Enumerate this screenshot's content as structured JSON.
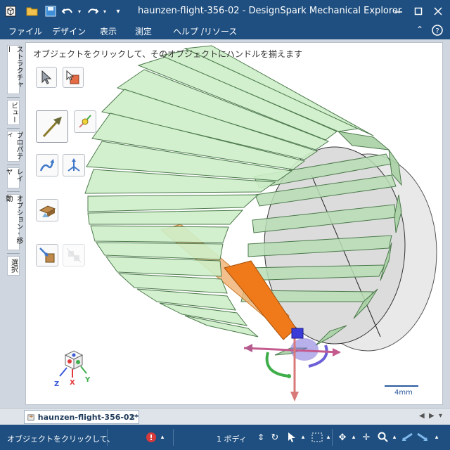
{
  "app": {
    "title": "haunzen-flight-356-02 - DesignSpark Mechanical Explorer",
    "icon": "cube-app-icon",
    "quick_access": [
      "open-folder-icon",
      "save-icon",
      "undo-icon",
      "redo-icon"
    ],
    "window_controls": [
      "minimize-icon",
      "maximize-icon",
      "close-icon"
    ]
  },
  "menu": {
    "items": [
      "ファイル",
      "デザイン",
      "表示",
      "測定",
      "ヘルプ /リソース"
    ],
    "collapse_icon": "chevron-up-icon",
    "help_icon": "help-icon"
  },
  "side_tabs": [
    "ストラクチャー",
    "ビュー",
    "プロパティ",
    "レイヤ",
    "オプション - 移動",
    "選択"
  ],
  "viewport": {
    "hint": "オブジェクトをクリックして、そのオブジェクトにハンドルを揃えます",
    "scale_label": "4mm",
    "axis_labels": {
      "x": "X",
      "y": "Y",
      "z": "Z"
    }
  },
  "tools": [
    "select-arrow-icon",
    "select-component-icon",
    "move-arrow-icon",
    "anchor-handle-icon",
    "move-along-path-icon",
    "orient-handle-icon",
    "ruler-dimension-icon",
    "move-up-to-icon",
    "create-pattern-icon"
  ],
  "document_tab": {
    "name": "haunzen-flight-356-02*",
    "close": "×"
  },
  "status": {
    "text": "オブジェクトをクリックして、",
    "bodies": "1 ボディ"
  },
  "colors": {
    "titlebar": "#1f4f80",
    "panel_green": "#c9ecc4",
    "panel_edge": "#4d7a4d",
    "orange_part": "#f07a1a",
    "selection_blue": "#2a5a9e"
  }
}
